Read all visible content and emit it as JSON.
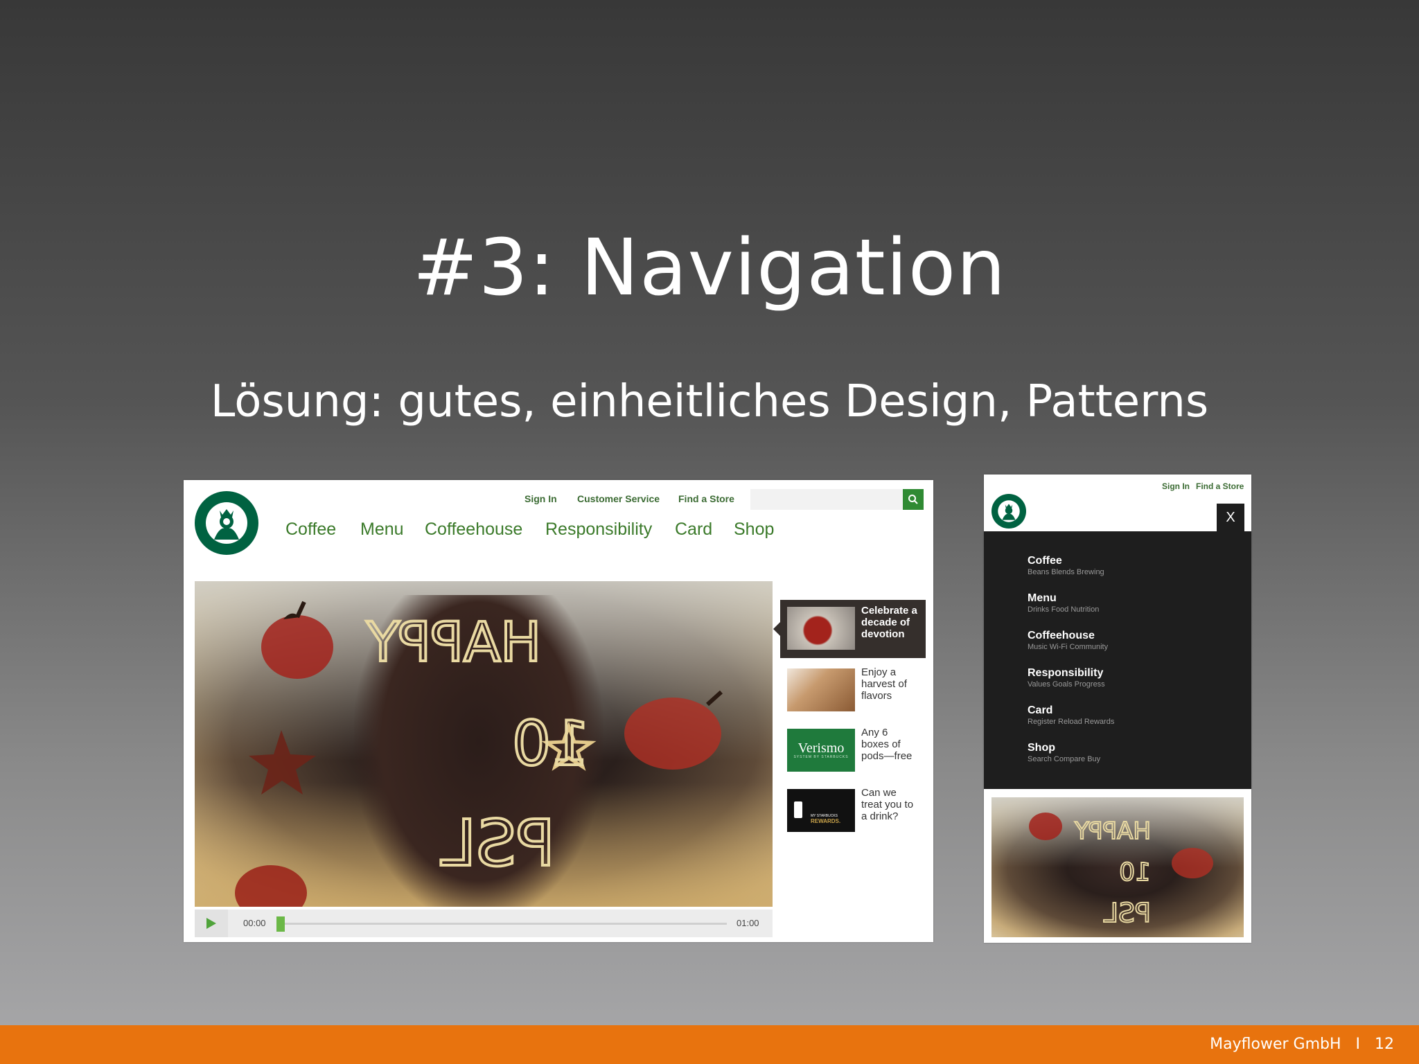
{
  "slide": {
    "title": "#3: Navigation",
    "subtitle": "Lösung: gutes, einheitliches Design, Patterns",
    "footer_company": "Mayflower GmbH",
    "footer_separator": "I",
    "page_number": "12"
  },
  "desktop": {
    "utility_links": [
      "Sign In",
      "Customer Service",
      "Find a Store"
    ],
    "search_placeholder": "",
    "nav": [
      "Coffee",
      "Menu",
      "Coffeehouse",
      "Responsibility",
      "Card",
      "Shop"
    ],
    "hero_text": [
      "HAPPY",
      "10",
      "PSL"
    ],
    "video": {
      "current_time": "00:00",
      "duration": "01:00",
      "progress": 0.0
    },
    "promos": [
      {
        "text": "Celebrate a\ndecade of\ndevotion",
        "active": true
      },
      {
        "text": "Enjoy a\nharvest of\nflavors",
        "active": false
      },
      {
        "text": "Any 6\nboxes of\npods—free",
        "active": false,
        "thumb_text": "Verismo",
        "thumb_subtext": "SYSTEM BY STARBUCKS"
      },
      {
        "text": "Can we\ntreat you to\na drink?",
        "active": false,
        "thumb_text": "REWARDS.",
        "thumb_subtext": "MY STARBUCKS"
      }
    ]
  },
  "mobile": {
    "utility_links": [
      "Sign In",
      "Find a Store"
    ],
    "close_label": "X",
    "menu": [
      {
        "label": "Coffee",
        "sub": "Beans Blends Brewing"
      },
      {
        "label": "Menu",
        "sub": "Drinks Food Nutrition"
      },
      {
        "label": "Coffeehouse",
        "sub": "Music Wi-Fi Community"
      },
      {
        "label": "Responsibility",
        "sub": "Values Goals Progress"
      },
      {
        "label": "Card",
        "sub": "Register Reload Rewards"
      },
      {
        "label": "Shop",
        "sub": "Search Compare Buy"
      }
    ]
  },
  "colors": {
    "accent_orange": "#e8730e",
    "nav_green": "#3b7a2a",
    "brand_green": "#006241",
    "menu_dark": "#1e1e1e"
  }
}
